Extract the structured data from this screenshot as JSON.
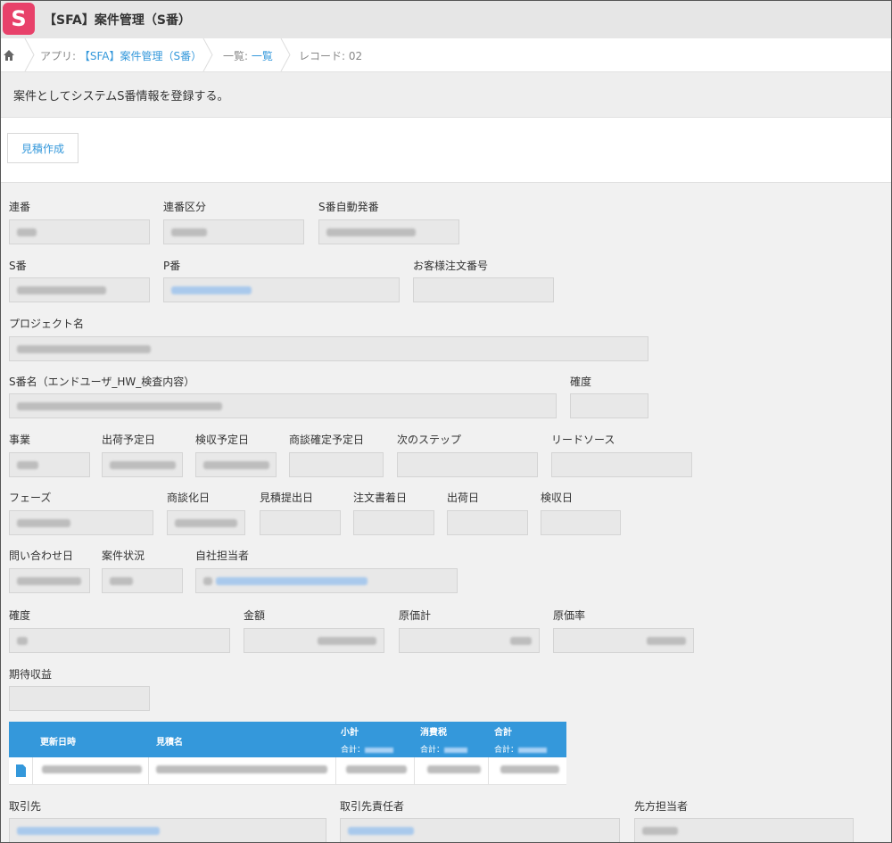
{
  "app": {
    "logo": "S",
    "title": "【SFA】案件管理（S番）"
  },
  "breadcrumb": {
    "home_icon": "home-icon",
    "app_prefix": "アプリ: ",
    "app_link": "【SFA】案件管理（S番）",
    "list_prefix": "一覧: ",
    "list_link": "一覧",
    "record": "レコード: 02"
  },
  "description": "案件としてシステムS番情報を登録する。",
  "toolbar": {
    "estimate_button": "見積作成"
  },
  "fields": {
    "renban": "連番",
    "renban_kubun": "連番区分",
    "s_auto": "S番自動発番",
    "s_ban": "S番",
    "p_ban": "P番",
    "customer_order_no": "お客様注文番号",
    "project_name": "プロジェクト名",
    "s_name": "S番名（エンドユーザ_HW_検査内容）",
    "certainty_1": "確度",
    "business": "事業",
    "ship_plan": "出荷予定日",
    "inspect_plan": "検収予定日",
    "deal_plan": "商談確定予定日",
    "next_step": "次のステップ",
    "lead_source": "リードソース",
    "phase": "フェーズ",
    "deal_date": "商談化日",
    "quote_date": "見積提出日",
    "order_date": "注文書着日",
    "ship_date": "出荷日",
    "inspect_date": "検収日",
    "inquiry_date": "問い合わせ日",
    "status": "案件状況",
    "owner": "自社担当者",
    "certainty_2": "確度",
    "amount": "金額",
    "cost_total": "原価計",
    "cost_rate": "原価率",
    "expected_profit": "期待収益",
    "client": "取引先",
    "client_manager": "取引先責任者",
    "client_contact": "先方担当者"
  },
  "table": {
    "col_updated": "更新日時",
    "col_quote": "見積名",
    "col_subtotal": "小計",
    "col_tax": "消費税",
    "col_total": "合計",
    "sum_label": "合計："
  },
  "colors": {
    "accent": "#3498db",
    "logo": "#e8416a"
  }
}
